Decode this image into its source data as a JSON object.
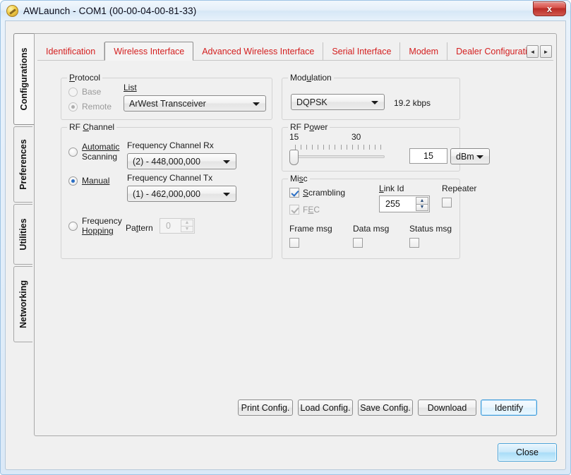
{
  "window": {
    "title": "AWLaunch - COM1  (00-00-04-00-81-33)",
    "icon": "app-icon",
    "close_label": "x"
  },
  "sidebar": {
    "items": [
      {
        "label": "Configurations",
        "active": true
      },
      {
        "label": "Preferences",
        "active": false
      },
      {
        "label": "Utilities",
        "active": false
      },
      {
        "label": "Networking",
        "active": false
      }
    ]
  },
  "tabs": {
    "items": [
      {
        "label": "Identification",
        "active": false
      },
      {
        "label": "Wireless Interface",
        "active": true
      },
      {
        "label": "Advanced Wireless Interface",
        "active": false
      },
      {
        "label": "Serial Interface",
        "active": false
      },
      {
        "label": "Modem",
        "active": false
      },
      {
        "label": "Dealer Configuratio",
        "active": false
      }
    ],
    "scroll_left": "◄",
    "scroll_right": "►"
  },
  "protocol": {
    "title": "Protocol",
    "base_label": "Base",
    "remote_label": "Remote",
    "selected": "Remote",
    "disabled": true,
    "list_label": "List",
    "list_value": "ArWest Transceiver"
  },
  "rf_channel": {
    "title": "RF Channel",
    "automatic_label_line1": "Automatic",
    "automatic_label_line2": "Scanning",
    "manual_label": "Manual",
    "hopping_label_line1": "Frequency",
    "hopping_label_line2": "Hopping",
    "selected": "Manual",
    "freq_rx_label": "Frequency Channel Rx",
    "freq_rx_value": "(2) - 448,000,000",
    "freq_tx_label": "Frequency Channel Tx",
    "freq_tx_value": "(1) - 462,000,000",
    "pattern_label": "Pattern",
    "pattern_value": "0",
    "pattern_disabled": true
  },
  "modulation": {
    "title": "Modulation",
    "value": "DQPSK",
    "rate": "19.2 kbps"
  },
  "rf_power": {
    "title": "RF Power",
    "min_label": "15",
    "max_label": "30",
    "value": "15",
    "unit": "dBm",
    "slider_position_pct": 0
  },
  "misc": {
    "title": "Misc",
    "scrambling_label": "Scrambling",
    "scrambling_checked": true,
    "fec_label": "FEC",
    "fec_checked": true,
    "fec_disabled": true,
    "link_id_label": "Link Id",
    "link_id_value": "255",
    "repeater_label": "Repeater",
    "repeater_checked": false,
    "frame_msg_label": "Frame msg",
    "frame_msg_checked": false,
    "data_msg_label": "Data msg",
    "data_msg_checked": false,
    "status_msg_label": "Status msg",
    "status_msg_checked": false
  },
  "actions": {
    "print_config": "Print Config.",
    "load_config": "Load Config.",
    "save_config": "Save Config.",
    "download": "Download",
    "identify": "Identify",
    "close": "Close"
  },
  "colors": {
    "tab_text": "#d41f1f",
    "accent": "#2a6ec4",
    "focus": "#3c9bdb"
  }
}
